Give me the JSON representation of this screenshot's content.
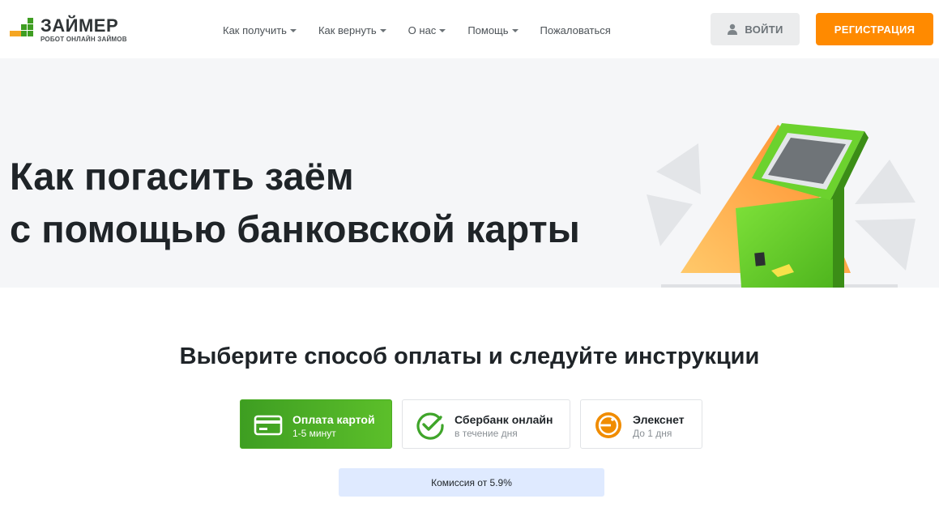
{
  "brand": {
    "name": "ЗАЙМЕР",
    "tagline": "РОБОТ ОНЛАЙН ЗАЙМОВ",
    "colors": {
      "green": "#3f9e22",
      "orange": "#f5a623"
    }
  },
  "nav": {
    "items": [
      {
        "label": "Как получить",
        "has_dropdown": true
      },
      {
        "label": "Как вернуть",
        "has_dropdown": true
      },
      {
        "label": "О нас",
        "has_dropdown": true
      },
      {
        "label": "Помощь",
        "has_dropdown": true
      },
      {
        "label": "Пожаловаться",
        "has_dropdown": false
      }
    ]
  },
  "header": {
    "login_label": "ВОЙТИ",
    "login_icon": "user-icon",
    "register_label": "РЕГИСТРАЦИЯ",
    "register_color": "#ff8a00"
  },
  "hero": {
    "title_line1": "Как погасить заём",
    "title_line2": "с помощью банковской карты",
    "illustration": "payment-terminal"
  },
  "payment": {
    "heading": "Выберите способ оплаты и следуйте инструкции",
    "methods": [
      {
        "title": "Оплата картой",
        "subtitle": "1-5 минут",
        "icon": "card-icon",
        "active": true
      },
      {
        "title": "Сбербанк онлайн",
        "subtitle": "в течение дня",
        "icon": "sberbank-check-icon",
        "active": false
      },
      {
        "title": "Элекснет",
        "subtitle": "До 1 дня",
        "icon": "elecsnet-icon",
        "active": false
      }
    ],
    "commission": "Комиссия от 5.9%"
  }
}
